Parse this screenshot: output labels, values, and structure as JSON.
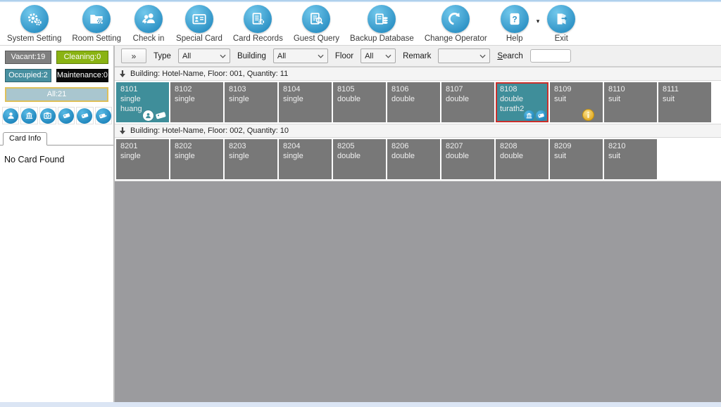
{
  "toolbar": {
    "items": [
      {
        "label": "System Setting",
        "icon": "gears-icon"
      },
      {
        "label": "Room Setting",
        "icon": "folder-gear-icon"
      },
      {
        "label": "Check in",
        "icon": "guests-add-icon"
      },
      {
        "label": "Special Card",
        "icon": "id-card-icon"
      },
      {
        "label": "Card Records",
        "icon": "records-gear-icon"
      },
      {
        "label": "Guest Query",
        "icon": "document-search-icon"
      },
      {
        "label": "Backup Database",
        "icon": "database-icon"
      },
      {
        "label": "Change Operator",
        "icon": "refresh-arrow-icon"
      },
      {
        "label": "Help",
        "icon": "question-icon",
        "caret": "caret-down-icon"
      },
      {
        "label": "Exit",
        "icon": "door-exit-icon"
      }
    ]
  },
  "sidebar": {
    "status": [
      {
        "label": "Vacant:19",
        "bg": "#7f7f7f"
      },
      {
        "label": "Cleaning:0",
        "bg": "#8ab313"
      },
      {
        "label": "Occupied:2",
        "bg": "#478fa0"
      },
      {
        "label": "Maintenance:0",
        "bg": "#0a0a0a"
      },
      {
        "label": "All:21",
        "bg": "#a9c6cf",
        "border": "#dec05a",
        "full": true
      }
    ],
    "quick_icons": [
      "person-icon",
      "building-icon",
      "camera-icon",
      "card-swipe-left-icon",
      "card-tag-icon",
      "card-swipe-right-icon"
    ],
    "tab_label": "Card Info",
    "card_status": "No Card Found"
  },
  "filters": {
    "expand_button": "»",
    "type_label": "Type",
    "type_value": "All",
    "building_label": "Building",
    "building_value": "All",
    "floor_label": "Floor",
    "floor_value": "All",
    "remark_label": "Remark",
    "remark_value": "",
    "search_label": "Search",
    "search_value": ""
  },
  "colors": {
    "accent_blue": "#3fa3d6",
    "vacant_gray": "#787878",
    "occupied_teal": "#3f8e9a",
    "selected_red": "#c9302c",
    "coin_gold": "#e8b429"
  },
  "floors": [
    {
      "header": "Building: Hotel-Name, Floor: 001, Quantity: 11",
      "rooms": [
        {
          "number": "8101",
          "type": "single",
          "guest": "huang",
          "state": "occupied",
          "badges": [
            "person-badge-icon",
            "card-tag-white-icon"
          ]
        },
        {
          "number": "8102",
          "type": "single",
          "state": "vacant"
        },
        {
          "number": "8103",
          "type": "single",
          "state": "vacant"
        },
        {
          "number": "8104",
          "type": "single",
          "state": "vacant"
        },
        {
          "number": "8105",
          "type": "double",
          "state": "vacant"
        },
        {
          "number": "8106",
          "type": "double",
          "state": "vacant"
        },
        {
          "number": "8107",
          "type": "double",
          "state": "vacant"
        },
        {
          "number": "8108",
          "type": "double",
          "guest": "turath2",
          "state": "occupied",
          "selected": true,
          "badges": [
            "building-badge-icon",
            "card-badge-icon"
          ]
        },
        {
          "number": "8109",
          "type": "suit",
          "state": "vacant",
          "badges": [
            "coin-icon"
          ]
        },
        {
          "number": "8110",
          "type": "suit",
          "state": "vacant"
        },
        {
          "number": "8111",
          "type": "suit",
          "state": "vacant"
        }
      ]
    },
    {
      "header": "Building: Hotel-Name, Floor: 002, Quantity: 10",
      "rooms": [
        {
          "number": "8201",
          "type": "single",
          "state": "vacant"
        },
        {
          "number": "8202",
          "type": "single",
          "state": "vacant"
        },
        {
          "number": "8203",
          "type": "single",
          "state": "vacant"
        },
        {
          "number": "8204",
          "type": "single",
          "state": "vacant"
        },
        {
          "number": "8205",
          "type": "double",
          "state": "vacant"
        },
        {
          "number": "8206",
          "type": "double",
          "state": "vacant"
        },
        {
          "number": "8207",
          "type": "double",
          "state": "vacant"
        },
        {
          "number": "8208",
          "type": "double",
          "state": "vacant"
        },
        {
          "number": "8209",
          "type": "suit",
          "state": "vacant"
        },
        {
          "number": "8210",
          "type": "suit",
          "state": "vacant"
        }
      ]
    }
  ]
}
